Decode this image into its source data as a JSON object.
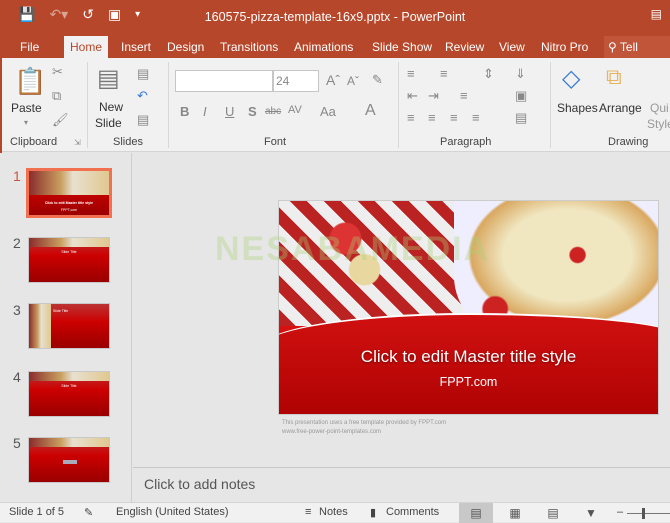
{
  "app": {
    "title": "160575-pizza-template-16x9.pptx - PowerPoint",
    "accent_color": "#b7472a"
  },
  "quick_access": {
    "save_icon": "save-icon",
    "undo_icon": "undo-icon",
    "redo_icon": "redo-icon",
    "present_icon": "present-from-start-icon",
    "customize_icon": "customize-qat-icon"
  },
  "tabs": [
    {
      "label": "File"
    },
    {
      "label": "Home",
      "active": true
    },
    {
      "label": "Insert"
    },
    {
      "label": "Design"
    },
    {
      "label": "Transitions"
    },
    {
      "label": "Animations"
    },
    {
      "label": "Slide Show"
    },
    {
      "label": "Review"
    },
    {
      "label": "View"
    },
    {
      "label": "Nitro Pro"
    },
    {
      "label": "Tell me..."
    }
  ],
  "ribbon": {
    "clipboard": {
      "label": "Clipboard",
      "paste": "Paste"
    },
    "slides": {
      "label": "Slides",
      "new_slide_1": "New",
      "new_slide_2": "Slide"
    },
    "font": {
      "label": "Font",
      "font_name": "",
      "font_size": "24",
      "bold": "B",
      "italic": "I",
      "underline": "U",
      "shadow": "S",
      "strike": "abc",
      "spacing": "AV",
      "case": "Aa",
      "color": "A",
      "grow": "Aˆ",
      "shrink": "Aˇ"
    },
    "paragraph": {
      "label": "Paragraph"
    },
    "drawing": {
      "label": "Drawing",
      "shapes": "Shapes",
      "arrange": "Arrange",
      "quick_styles_1": "Qui",
      "quick_styles_2": "Style"
    }
  },
  "thumbnails": [
    {
      "num": "1",
      "title": "Click to edit Master title style",
      "sub": "FPPT.com"
    },
    {
      "num": "2",
      "title": "Slide Title"
    },
    {
      "num": "3",
      "title": "Slide Title"
    },
    {
      "num": "4",
      "title": "Slide Title"
    },
    {
      "num": "5",
      "title": ""
    }
  ],
  "slide": {
    "title": "Click to edit Master title style",
    "subtitle": "FPPT.com",
    "credit_1": "This presentation uses a free template provided by FPPT.com",
    "credit_2": "www.free-power-point-templates.com",
    "watermark": "NESABAMEDIA"
  },
  "notes": {
    "placeholder": "Click to add notes"
  },
  "status": {
    "slide_count": "Slide 1 of 5",
    "language": "English (United States)",
    "notes": "Notes",
    "comments": "Comments"
  }
}
